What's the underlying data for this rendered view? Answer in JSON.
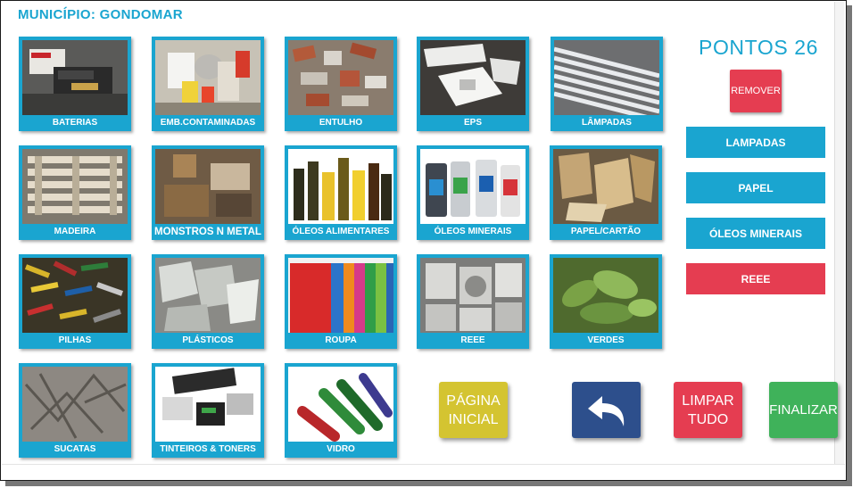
{
  "header": {
    "title": "MUNICÍPIO: GONDOMAR"
  },
  "points": {
    "label": "PONTOS 26"
  },
  "remove_button": "REMOVER",
  "categories": [
    {
      "label": "BATERIAS"
    },
    {
      "label": "EMB.CONTAMINADAS"
    },
    {
      "label": "ENTULHO"
    },
    {
      "label": "EPS"
    },
    {
      "label": "LÂMPADAS"
    },
    {
      "label": "MADEIRA"
    },
    {
      "label": "MONSTROS N METAL"
    },
    {
      "label": "ÓLEOS ALIMENTARES"
    },
    {
      "label": "ÓLEOS MINERAIS"
    },
    {
      "label": "PAPEL/CARTÃO"
    },
    {
      "label": "PILHAS"
    },
    {
      "label": "PLÁSTICOS"
    },
    {
      "label": "ROUPA"
    },
    {
      "label": "REEE"
    },
    {
      "label": "VERDES"
    },
    {
      "label": "SUCATAS"
    },
    {
      "label": "TINTEIROS & TONERS"
    },
    {
      "label": "VIDRO"
    }
  ],
  "selected": [
    {
      "label": "LAMPADAS",
      "color": "#1aa5d0"
    },
    {
      "label": "PAPEL",
      "color": "#1aa5d0"
    },
    {
      "label": "ÓLEOS MINERAIS",
      "color": "#1aa5d0"
    },
    {
      "label": "REEE",
      "color": "#e53d51"
    }
  ],
  "actions": {
    "home_label": "PÁGINA INICIAL",
    "back_icon": "undo-arrow-icon",
    "clear_label": "LIMPAR TUDO",
    "finish_label": "FINALIZAR"
  },
  "colors": {
    "accent": "#1aa5d0",
    "danger": "#e53d51",
    "home": "#d4c431",
    "back": "#2d4f8c",
    "finish": "#3fb25a"
  }
}
